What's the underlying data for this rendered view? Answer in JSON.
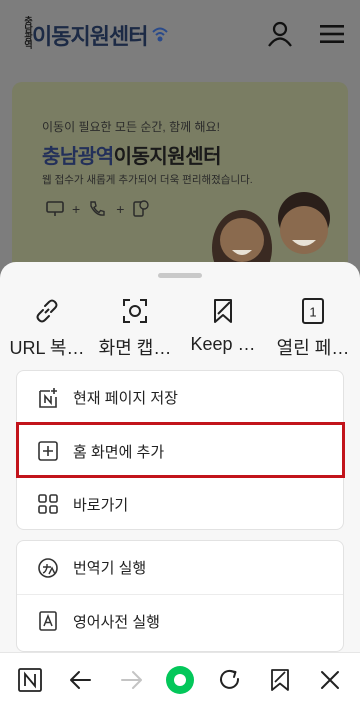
{
  "header": {
    "logo_seal": "충남광역",
    "logo_text": "이동지원센터"
  },
  "banner": {
    "subtitle": "이동이 필요한 모든 순간, 함께 해요!",
    "title_highlight": "충남광역",
    "title_rest": "이동지원센터",
    "description": "웹 접수가 새롭게 추가되어 더욱 편리해졌습니다.",
    "icon_plus": "+",
    "icon_24": "24"
  },
  "quick_actions": [
    {
      "label": "URL 복…",
      "icon": "link-icon"
    },
    {
      "label": "화면 캡…",
      "icon": "capture-icon"
    },
    {
      "label": "Keep …",
      "icon": "keep-icon"
    },
    {
      "label": "열린 페…",
      "icon": "open-pages-icon"
    }
  ],
  "open_pages_count": "1",
  "menu": {
    "save_page": "현재 페이지 저장",
    "add_home": "홈 화면에 추가",
    "shortcuts": "바로가기",
    "translate": "번역기 실행",
    "dictionary": "영어사전 실행"
  },
  "colors": {
    "highlight_border": "#c2141b",
    "dim_overlay": "#7d7d7d",
    "naver_green": "#03c75a"
  }
}
